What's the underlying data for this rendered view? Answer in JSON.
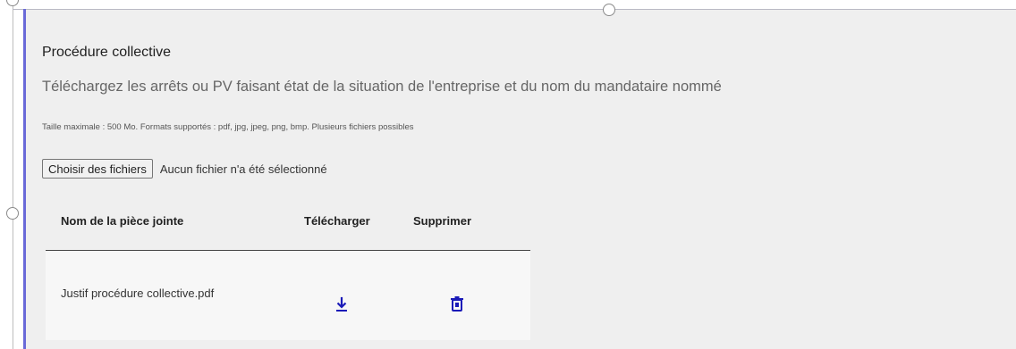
{
  "section": {
    "title": "Procédure collective",
    "subtitle": "Téléchargez les arrêts ou PV faisant état de la situation de l'entreprise et du nom du mandataire nommé",
    "hint": "Taille maximale : 500 Mo. Formats supportés : pdf, jpg, jpeg, png, bmp. Plusieurs fichiers possibles"
  },
  "file_input": {
    "button_label": "Choisir des fichiers",
    "status": "Aucun fichier n'a été sélectionné"
  },
  "attachments": {
    "headers": {
      "name": "Nom de la pièce jointe",
      "download": "Télécharger",
      "delete": "Supprimer"
    },
    "rows": [
      {
        "name": "Justif procédure collective.pdf",
        "download_icon": "download-icon",
        "delete_icon": "trash-icon"
      }
    ]
  },
  "colors": {
    "accent": "#1a1ab8",
    "selection_bar": "#6a6ad8",
    "panel_bg": "#efefef"
  }
}
